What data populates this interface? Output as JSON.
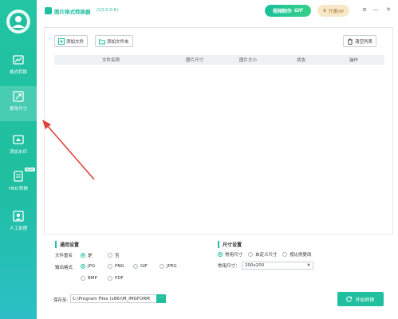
{
  "window": {
    "title": "图片格式转换器",
    "version": "(V2.0.0.6)",
    "gif_button_text": "视频制作",
    "gif_button_tag": "GIF",
    "vip_button": "开通VIP",
    "controls": [
      "≡",
      "—",
      "✕"
    ]
  },
  "sidebar": {
    "items": [
      {
        "label": "格式转换",
        "icon": "convert-icon"
      },
      {
        "label": "更改尺寸",
        "icon": "resize-icon",
        "active": true
      },
      {
        "label": "添加水印",
        "icon": "watermark-icon"
      },
      {
        "label": "HEIC转换",
        "icon": "heic-icon",
        "badge": "NEW"
      },
      {
        "label": "人工处理",
        "icon": "manual-icon"
      }
    ]
  },
  "toolbar": {
    "add_file": "添加文件",
    "add_folder": "添加文件夹",
    "clear_list": "清空列表"
  },
  "table": {
    "columns": [
      "文件名称",
      "图片尺寸",
      "图片大小",
      "状态",
      "操作"
    ]
  },
  "settings": {
    "general_title": "通用设置",
    "rename_label": "文件重名",
    "rename_options": [
      "是",
      "否"
    ],
    "rename_selected": "是",
    "format_label": "输出格式",
    "formats": [
      "JPG",
      "PNG",
      "GIF",
      "JPEG",
      "BMP",
      "PDF"
    ],
    "format_selected": "JPG",
    "size_title": "尺寸设置",
    "size_modes": [
      "常用尺寸",
      "自定义尺寸",
      "按比例更改"
    ],
    "size_mode_selected": "常用尺寸",
    "common_size_label": "常用尺寸：",
    "common_size_value": "200x200"
  },
  "bottom": {
    "save_label": "保存至:",
    "save_path": "C:\\Program Files (x86)\\M_IMGFORM",
    "browse": "···",
    "start": "开始转换"
  },
  "colors": {
    "accent": "#1fbf9f",
    "annotation": "#e0413a"
  }
}
